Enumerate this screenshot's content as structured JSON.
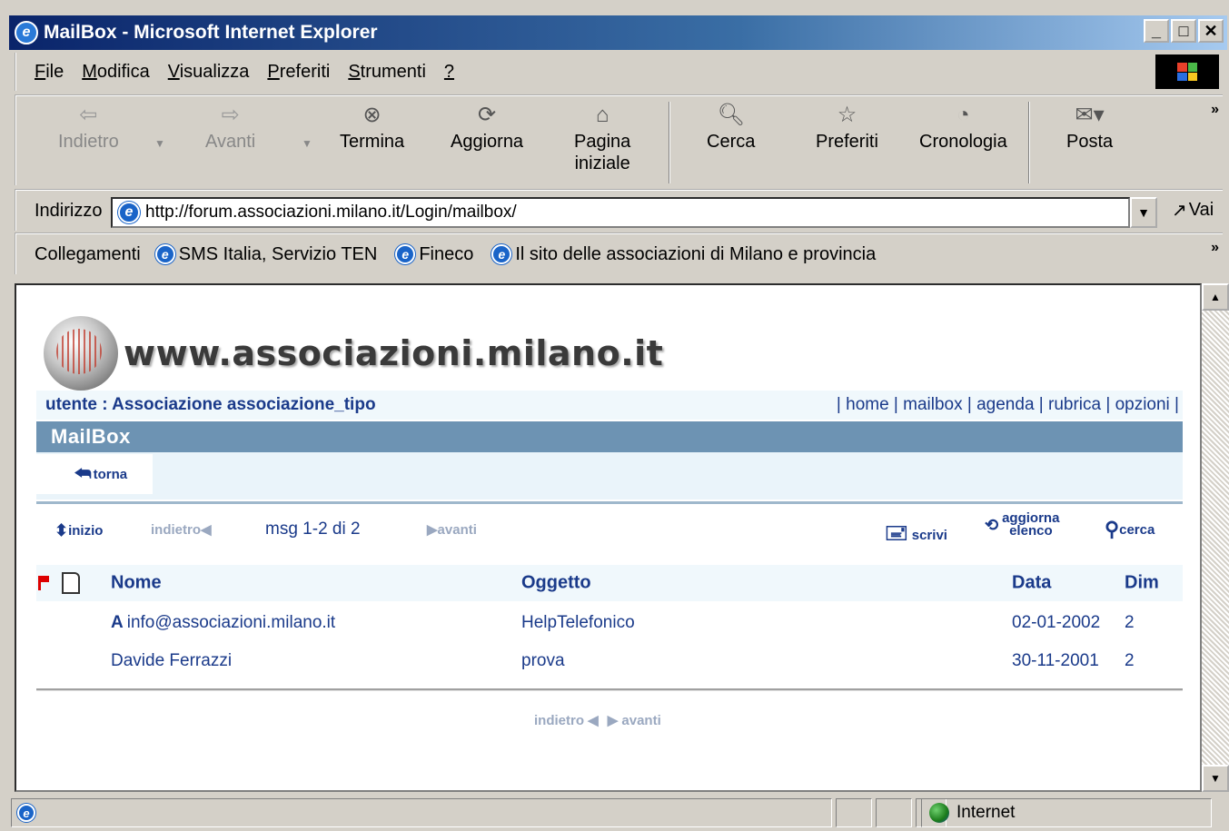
{
  "window": {
    "title": "MailBox - Microsoft Internet Explorer",
    "app_icon": "ie-icon",
    "controls": [
      "minimize",
      "maximize",
      "close"
    ]
  },
  "menu": {
    "items": [
      {
        "label": "File",
        "accel": "F"
      },
      {
        "label": "Modifica",
        "accel": "M"
      },
      {
        "label": "Visualizza",
        "accel": "V"
      },
      {
        "label": "Preferiti",
        "accel": "P"
      },
      {
        "label": "Strumenti",
        "accel": "S"
      },
      {
        "label": "?",
        "accel": "?"
      }
    ]
  },
  "toolbar": {
    "back": "Indietro",
    "forward": "Avanti",
    "stop": "Termina",
    "refresh": "Aggiorna",
    "home_line1": "Pagina",
    "home_line2": "iniziale",
    "search": "Cerca",
    "favorites": "Preferiti",
    "history": "Cronologia",
    "mail": "Posta"
  },
  "address": {
    "label": "Indirizzo",
    "url": "http://forum.associazioni.milano.it/Login/mailbox/",
    "go": "Vai"
  },
  "links": {
    "label": "Collegamenti",
    "items": [
      "SMS Italia, Servizio TEN",
      "Fineco",
      "Il sito delle associazioni di Milano e provincia"
    ]
  },
  "page": {
    "site_logo": "www.associazioni.milano.it",
    "user": "utente : Associazione associazione_tipo",
    "nav": "| home | mailbox | agenda | rubrica | opzioni |",
    "section_title": "MailBox",
    "back_link": "torna",
    "pager": {
      "start": "inizio",
      "prev": "indietro",
      "count": "msg 1-2 di 2",
      "next": "avanti",
      "write": "scrivi",
      "refresh_line1": "aggiorna",
      "refresh_line2": "elenco",
      "search": "cerca"
    },
    "table": {
      "headers": {
        "name": "Nome",
        "subject": "Oggetto",
        "date": "Data",
        "size": "Dim"
      },
      "rows": [
        {
          "prefix": "A",
          "name": "info@associazioni.milano.it",
          "subject": "HelpTelefonico",
          "date": "02-01-2002",
          "size": "2"
        },
        {
          "prefix": "",
          "name": "Davide Ferrazzi",
          "subject": "prova",
          "date": "30-11-2001",
          "size": "2"
        }
      ]
    },
    "bottom_nav": {
      "prev": "indietro",
      "next": "avanti"
    }
  },
  "status": {
    "zone": "Internet"
  },
  "colors": {
    "title_gradient_start": "#0a246a",
    "section_header": "#6d93b3",
    "link_blue": "#1a3a8a"
  }
}
